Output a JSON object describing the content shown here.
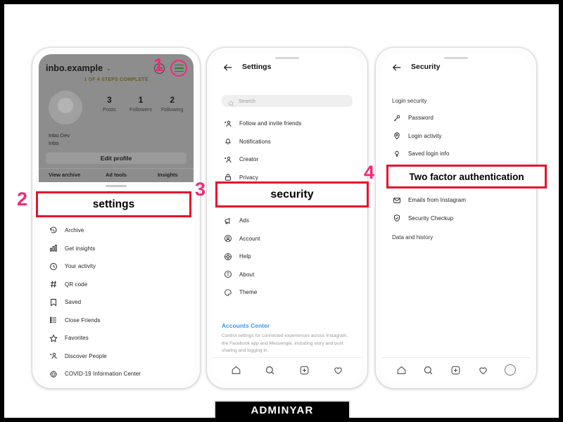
{
  "brand": {
    "label": "ADMINYAR"
  },
  "markers": {
    "one": "1",
    "two": "2",
    "three": "3",
    "four": "4",
    "accent_color": "#ee2a7b",
    "callout_border_color": "#e8112d"
  },
  "callouts": {
    "settings": "settings",
    "security": "security",
    "two_factor": "Two factor authentication"
  },
  "phone1": {
    "username": "inbo.example",
    "caret": "⌄",
    "steps_text": "1 OF 4 STEPS COMPLETE",
    "steps_caret": "⌄",
    "stats": [
      {
        "value": "3",
        "label": "Posts"
      },
      {
        "value": "1",
        "label": "Followers"
      },
      {
        "value": "2",
        "label": "Following"
      }
    ],
    "display_name": "Inbo Dev",
    "bio": "Inbo",
    "edit_profile": "Edit profile",
    "tabs": [
      {
        "label": "View archive"
      },
      {
        "label": "Ad tools"
      },
      {
        "label": "Insights"
      }
    ],
    "menu": [
      {
        "icon": "archive-icon",
        "label": "Archive"
      },
      {
        "icon": "insights-icon",
        "label": "Get insights"
      },
      {
        "icon": "clock-icon",
        "label": "Your activity"
      },
      {
        "icon": "qr-code-icon",
        "label": "QR code"
      },
      {
        "icon": "bookmark-icon",
        "label": "Saved"
      },
      {
        "icon": "list-icon",
        "label": "Close Friends"
      },
      {
        "icon": "star-icon",
        "label": "Favorites"
      },
      {
        "icon": "person-add-icon",
        "label": "Discover People"
      },
      {
        "icon": "covid-icon",
        "label": "COVID-19 Information Center"
      }
    ]
  },
  "phone2": {
    "title": "Settings",
    "back_icon": "back-arrow-icon",
    "search_placeholder": "Search",
    "menu_top": [
      {
        "icon": "person-add-icon",
        "label": "Follow and invite friends"
      },
      {
        "icon": "bell-icon",
        "label": "Notifications"
      },
      {
        "icon": "person-add-icon",
        "label": "Creator"
      },
      {
        "icon": "lock-icon",
        "label": "Privacy"
      }
    ],
    "menu_bottom": [
      {
        "icon": "megaphone-icon",
        "label": "Ads"
      },
      {
        "icon": "account-icon",
        "label": "Account"
      },
      {
        "icon": "help-icon",
        "label": "Help"
      },
      {
        "icon": "info-icon",
        "label": "About"
      },
      {
        "icon": "theme-icon",
        "label": "Theme"
      }
    ],
    "accounts_center": "Accounts Center",
    "accounts_center_desc": "Control settings for connected experiences across Instagram, the Facebook app and Messenger, including story and post sharing and logging in.",
    "bottom_nav": [
      {
        "icon": "home-icon"
      },
      {
        "icon": "search-icon"
      },
      {
        "icon": "add-post-icon"
      },
      {
        "icon": "heart-icon"
      }
    ]
  },
  "phone3": {
    "title": "Security",
    "back_icon": "back-arrow-icon",
    "group_login": "Login security",
    "group_data": "Data and history",
    "menu_top": [
      {
        "icon": "key-icon",
        "label": "Password"
      },
      {
        "icon": "location-icon",
        "label": "Login activity"
      },
      {
        "icon": "saved-login-icon",
        "label": "Saved login info"
      }
    ],
    "menu_bottom": [
      {
        "icon": "mail-icon",
        "label": "Emails from Instagram"
      },
      {
        "icon": "shield-check-icon",
        "label": "Security Checkup"
      }
    ],
    "bottom_nav": [
      {
        "icon": "home-icon"
      },
      {
        "icon": "search-icon"
      },
      {
        "icon": "add-post-icon"
      },
      {
        "icon": "heart-icon"
      },
      {
        "icon": "profile-avatar-icon"
      }
    ]
  }
}
